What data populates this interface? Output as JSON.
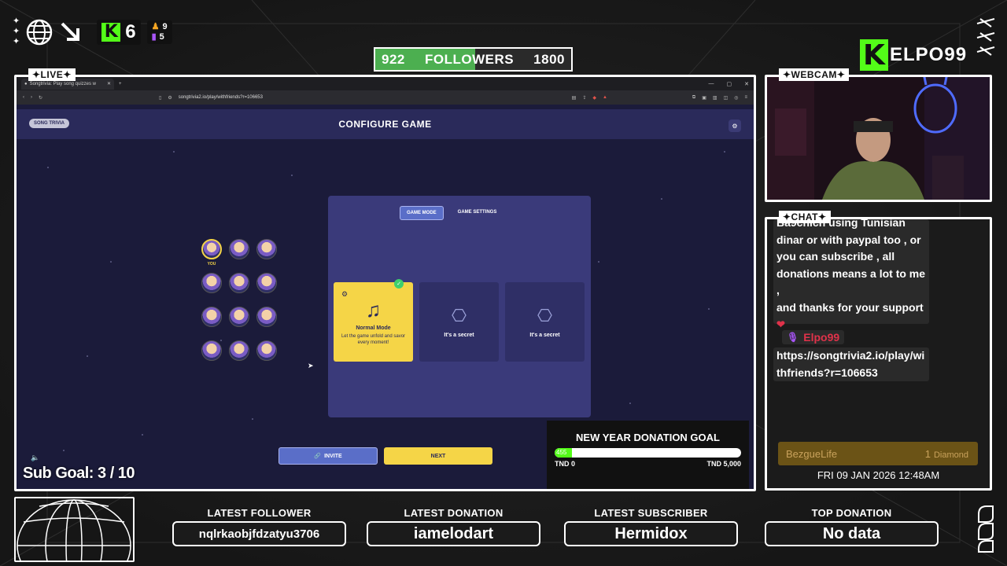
{
  "top_bar": {
    "kick_count": "6",
    "viewers_top": "9",
    "viewers_bottom": "5",
    "followers_current": "922",
    "followers_label": "FOLLOWERS",
    "followers_goal": "1800",
    "followers_progress": 0.512,
    "brand_name": "ELPO99"
  },
  "frames": {
    "live_label": "✦LIVE✦",
    "webcam_label": "✦WEBCAM✦",
    "chat_label": "✦CHAT✦"
  },
  "browser": {
    "tab_title": "Songtrivia: Play song quizzes w",
    "url": "songtrivia2.io/play/withfriends?r=106653"
  },
  "game": {
    "logo_text": "SONG TRIVIA",
    "title": "CONFIGURE GAME",
    "tabs": [
      {
        "label": "GAME MODE",
        "active": true
      },
      {
        "label": "GAME SETTINGS",
        "active": false
      }
    ],
    "you_label": "YOU",
    "cards": [
      {
        "title": "Normal Mode",
        "desc": "Let the game unfold and savor every moment!",
        "selected": true
      },
      {
        "title": "It's a secret",
        "desc": "",
        "selected": false
      },
      {
        "title": "It's a secret",
        "desc": "",
        "selected": false
      }
    ],
    "invite_label": "INVITE",
    "next_label": "NEXT"
  },
  "overlay": {
    "sub_goal_label": "Sub Goal:",
    "sub_goal_value": "3 / 10",
    "donation_title": "NEW YEAR DONATION GOAL",
    "donation_current": "455",
    "donation_progress": 0.091,
    "donation_min": "TND 0",
    "donation_max": "TND 5,000"
  },
  "chat": {
    "msg1_lines": [
      "Ba9chich using Tunisian",
      "dinar or with paypal too , or",
      "you can subscribe , all",
      "donations means a lot to me ,",
      "and thanks for your support"
    ],
    "user": "Elpo99",
    "msg2_lines": [
      "https://songtrivia2.io/play/wi",
      "thfriends?r=106653"
    ],
    "event_user": "BezgueLife",
    "event_amount": "1",
    "event_unit": "Diamond",
    "datetime": "FRI 09 JAN 2026 12:48AM"
  },
  "bottom": {
    "stats": [
      {
        "label": "LATEST FOLLOWER",
        "value": "nqlrkaobjfdzatyu3706"
      },
      {
        "label": "LATEST DONATION",
        "value": "iamelodart"
      },
      {
        "label": "LATEST SUBSCRIBER",
        "value": "Hermidox"
      },
      {
        "label": "TOP DONATION",
        "value": "No data"
      }
    ]
  },
  "colors": {
    "kick_green": "#53fc18",
    "game_bg": "#1b1b3a",
    "panel": "#3a3a7a",
    "accent_yellow": "#f5d547",
    "accent_blue": "#5a6ec8"
  }
}
